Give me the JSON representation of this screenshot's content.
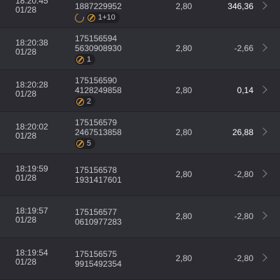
{
  "rows": [
    {
      "time": "18:20:45",
      "date": "01/28",
      "id_line1": "",
      "id_line2": "1887229952",
      "badge_refresh": true,
      "badge_count": "1+10",
      "odds": "2,80",
      "result": "346,36",
      "win": true
    },
    {
      "time": "18:20:38",
      "date": "01/28",
      "id_line1": "175156594",
      "id_line2": "5630908930",
      "badge_refresh": false,
      "badge_count": "1",
      "odds": "2,80",
      "result": "-2,66",
      "win": false
    },
    {
      "time": "18:20:28",
      "date": "01/28",
      "id_line1": "175156590",
      "id_line2": "4128249858",
      "badge_refresh": false,
      "badge_count": "2",
      "odds": "2,80",
      "result": "0,14",
      "win": true
    },
    {
      "time": "18:20:02",
      "date": "01/28",
      "id_line1": "175156579",
      "id_line2": "2467513858",
      "badge_refresh": false,
      "badge_count": "5",
      "odds": "2,80",
      "result": "26,88",
      "win": true
    },
    {
      "time": "18:19:59",
      "date": "01/28",
      "id_line1": "175156578",
      "id_line2": "1931417601",
      "badge_refresh": false,
      "badge_count": "",
      "odds": "2,80",
      "result": "-2,80",
      "win": false
    },
    {
      "time": "18:19:57",
      "date": "01/28",
      "id_line1": "175156577",
      "id_line2": "0610977283",
      "badge_refresh": false,
      "badge_count": "",
      "odds": "2,80",
      "result": "-2,80",
      "win": false
    },
    {
      "time": "18:19:54",
      "date": "01/28",
      "id_line1": "175156575",
      "id_line2": "9915492354",
      "badge_refresh": false,
      "badge_count": "",
      "odds": "2,80",
      "result": "-2,80",
      "win": false
    }
  ]
}
